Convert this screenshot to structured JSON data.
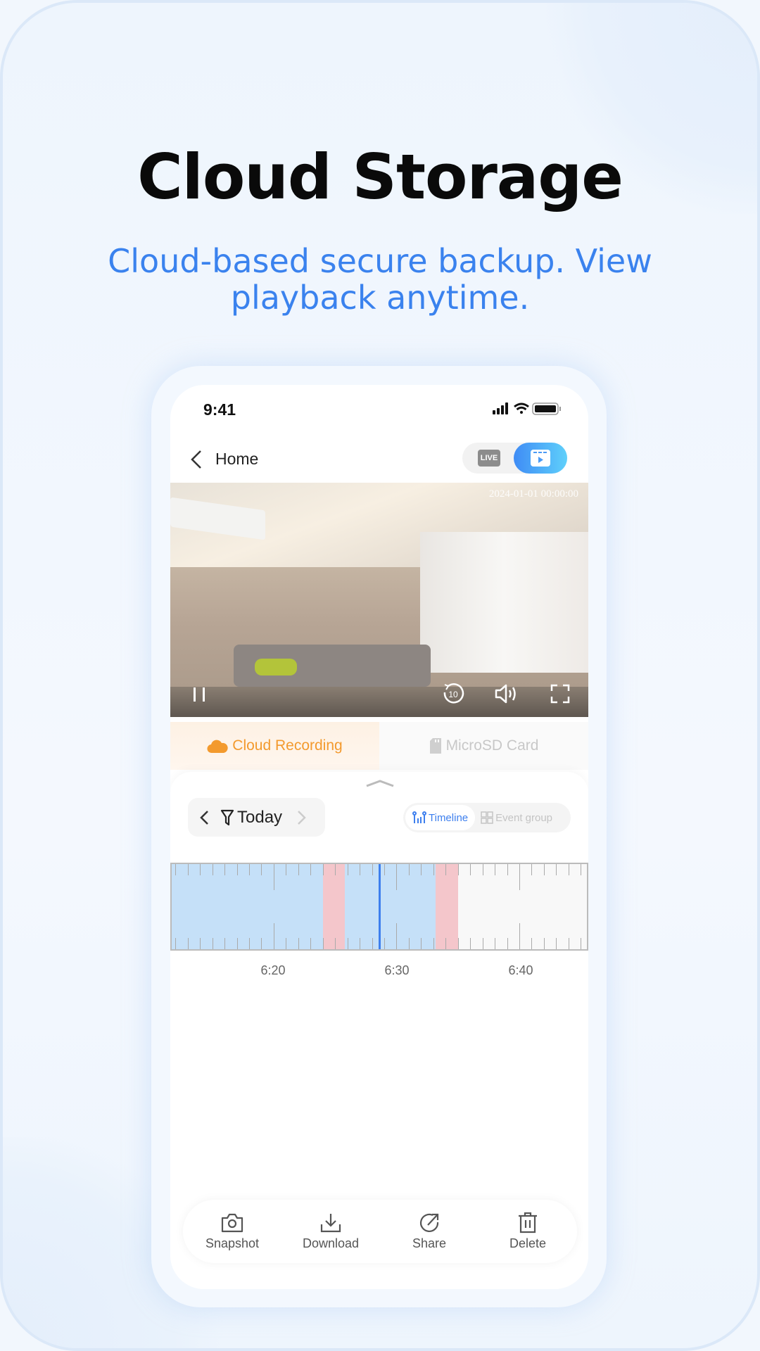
{
  "headline": {
    "title": "Cloud Storage",
    "subtitle": "Cloud-based secure backup. View playback anytime."
  },
  "status_bar": {
    "time": "9:41",
    "icons": [
      "signal-icon",
      "wifi-icon",
      "battery-icon"
    ]
  },
  "nav": {
    "back_label": "Home",
    "modes": [
      {
        "label": "LIVE",
        "icon": "live-tv-icon",
        "active": false
      },
      {
        "icon": "playback-icon",
        "active": true
      }
    ]
  },
  "video": {
    "timestamp": "2024-01-01 00:00:00",
    "controls": [
      "pause-icon",
      "replay-10-icon",
      "volume-icon",
      "fullscreen-icon"
    ],
    "replay_seconds": "10"
  },
  "storage_tabs": [
    {
      "label": "Cloud Recording",
      "icon": "cloud-icon",
      "active": true,
      "color": "#f39a2e"
    },
    {
      "label": "MicroSD Card",
      "icon": "sd-card-icon",
      "active": false,
      "color": "#c8c8c8"
    }
  ],
  "date_filter": {
    "label": "Today"
  },
  "view_toggle": [
    {
      "label": "Timeline",
      "active": true
    },
    {
      "label": "Event group",
      "active": false
    }
  ],
  "timeline": {
    "tick_labels": [
      "6:20",
      "6:30",
      "6:40"
    ],
    "range_minutes": [
      371.7,
      405.5
    ],
    "cursor_minute": 388.6,
    "segments": [
      {
        "type": "recording",
        "start": 371.7,
        "end": 384.0
      },
      {
        "type": "event",
        "start": 384.0,
        "end": 385.8
      },
      {
        "type": "recording",
        "start": 385.8,
        "end": 393.2
      },
      {
        "type": "event",
        "start": 393.2,
        "end": 395.0
      }
    ],
    "colors": {
      "recording": "#c5e0f8",
      "event": "#f4c6cb",
      "cursor": "#3d7fee"
    }
  },
  "actions": [
    {
      "label": "Snapshot",
      "icon": "camera-icon"
    },
    {
      "label": "Download",
      "icon": "download-icon"
    },
    {
      "label": "Share",
      "icon": "share-icon"
    },
    {
      "label": "Delete",
      "icon": "trash-icon"
    }
  ]
}
